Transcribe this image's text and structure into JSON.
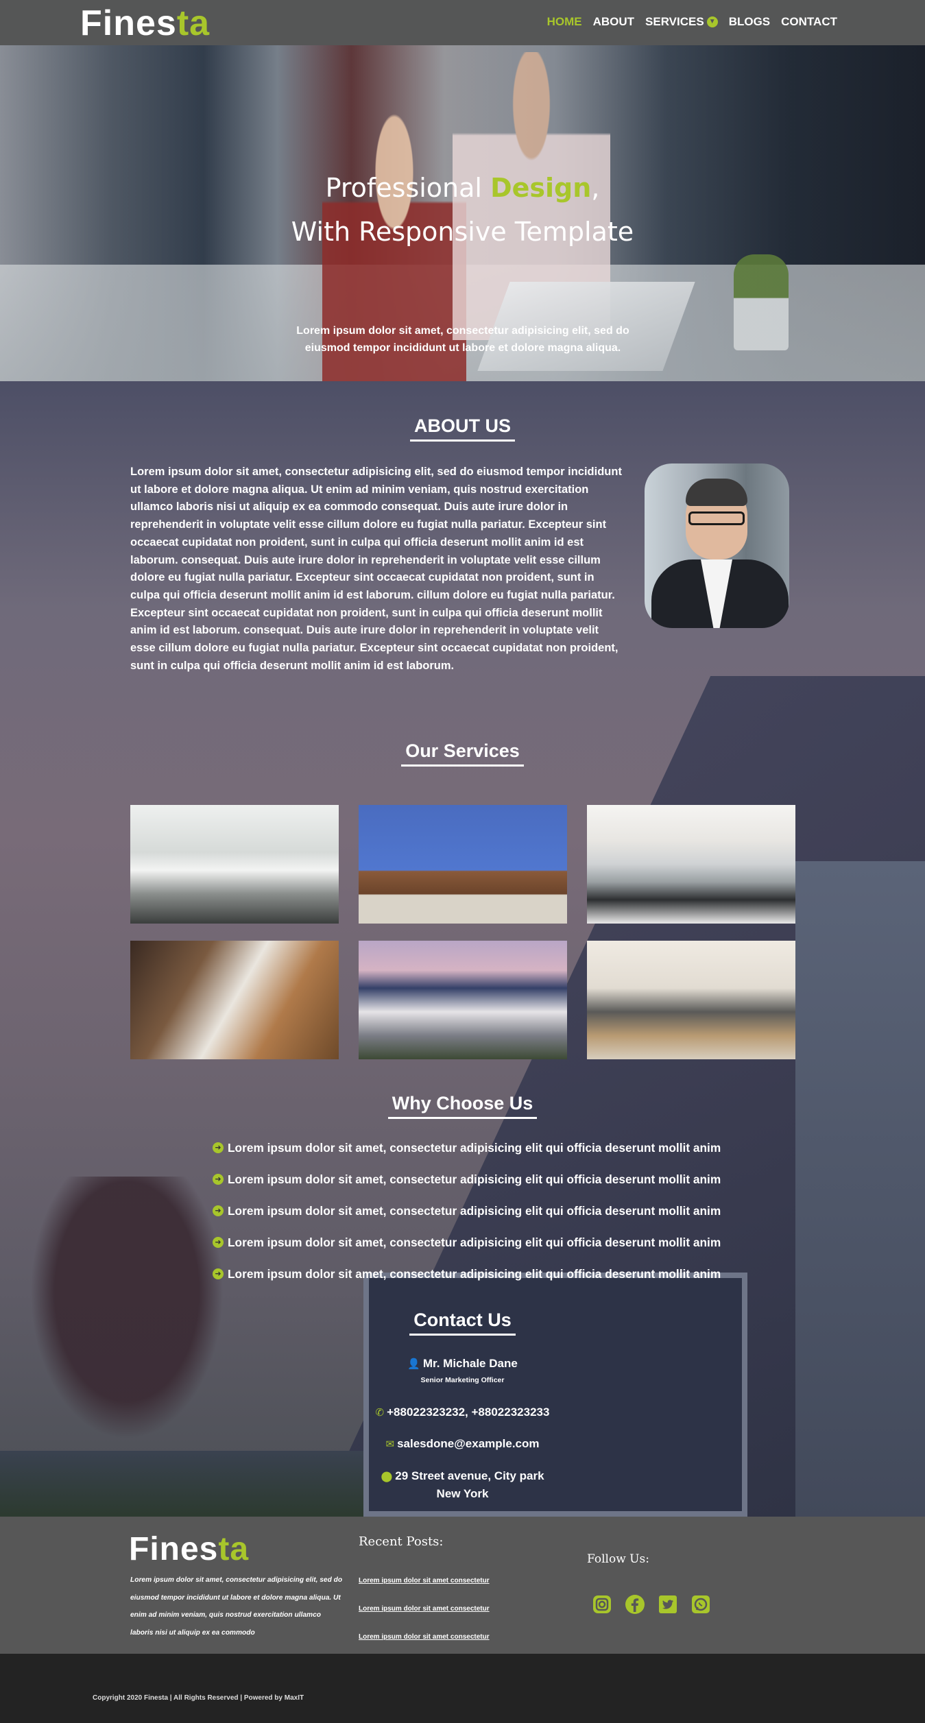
{
  "brand": {
    "name_main": "Fines",
    "name_accent": "ta",
    "accent_color": "#a8c62b"
  },
  "nav": {
    "items": [
      {
        "label": "HOME",
        "active": true
      },
      {
        "label": "ABOUT"
      },
      {
        "label": "SERVICES",
        "has_dropdown": true
      },
      {
        "label": "BLOGS"
      },
      {
        "label": "CONTACT"
      }
    ]
  },
  "hero": {
    "title_line1_a": "Professional ",
    "title_line1_accent": "Design",
    "title_line1_b": ",",
    "title_line2": "With Responsive Template",
    "subtitle": "Lorem ipsum dolor sit amet, consectetur adipisicing elit, sed do eiusmod tempor incididunt ut labore et dolore magna aliqua.",
    "slides": 4,
    "active_slide": 4
  },
  "about": {
    "title": "ABOUT US",
    "text": "Lorem ipsum dolor sit amet, consectetur adipisicing elit, sed do eiusmod tempor incididunt ut labore et dolore magna aliqua. Ut enim ad minim veniam, quis nostrud exercitation ullamco laboris nisi ut aliquip ex ea commodo consequat. Duis aute irure dolor in reprehenderit in voluptate velit esse cillum dolore eu fugiat nulla pariatur. Excepteur sint occaecat cupidatat non proident, sunt in culpa qui officia deserunt mollit anim id est laborum. consequat. Duis aute irure dolor in reprehenderit in voluptate velit esse cillum dolore eu fugiat nulla pariatur. Excepteur sint occaecat cupidatat non proident, sunt in culpa qui officia deserunt mollit anim id est laborum. cillum dolore eu fugiat nulla pariatur. Excepteur sint occaecat cupidatat non proident, sunt in culpa qui officia deserunt mollit anim id est laborum. consequat. Duis aute irure dolor in reprehenderit in voluptate velit esse cillum dolore eu fugiat nulla pariatur. Excepteur sint occaecat cupidatat non proident, sunt in culpa qui officia deserunt mollit anim id est laborum."
  },
  "services": {
    "title": "Our Services"
  },
  "why": {
    "title": "Why Choose Us",
    "items": [
      "Lorem ipsum dolor sit amet, consectetur adipisicing elit qui officia deserunt mollit anim",
      "Lorem ipsum dolor sit amet, consectetur adipisicing elit qui officia deserunt mollit anim",
      "Lorem ipsum dolor sit amet, consectetur adipisicing elit qui officia deserunt mollit anim",
      "Lorem ipsum dolor sit amet, consectetur adipisicing elit qui officia deserunt mollit anim",
      "Lorem ipsum dolor sit amet, consectetur adipisicing elit qui officia deserunt mollit anim"
    ]
  },
  "contact": {
    "title": "Contact Us",
    "name": "Mr. Michale Dane",
    "role": "Senior Marketing Officer",
    "phone": "+88022323232, +88022323233",
    "email": "salesdone@example.com",
    "address_line1": "29 Street avenue, City park",
    "address_line2": "New York"
  },
  "footer": {
    "about": "Lorem ipsum dolor sit amet, consectetur adipisicing elit, sed do eiusmod tempor incididunt ut labore et dolore magna aliqua. Ut enim ad minim veniam, quis nostrud exercitation ullamco laboris nisi ut aliquip ex ea commodo",
    "recent_title": "Recent Posts:",
    "recent_links": [
      "Lorem ipsum dolor sit amet consectetur",
      "Lorem ipsum dolor sit amet consectetur",
      "Lorem ipsum dolor sit amet consectetur"
    ],
    "follow_title": "Follow Us:",
    "socials": [
      "instagram-icon",
      "facebook-icon",
      "twitter-icon",
      "whatsapp-icon"
    ],
    "copyright": "Copyright 2020 Finesta | All Rights Reserved | Powered by MaxIT"
  }
}
